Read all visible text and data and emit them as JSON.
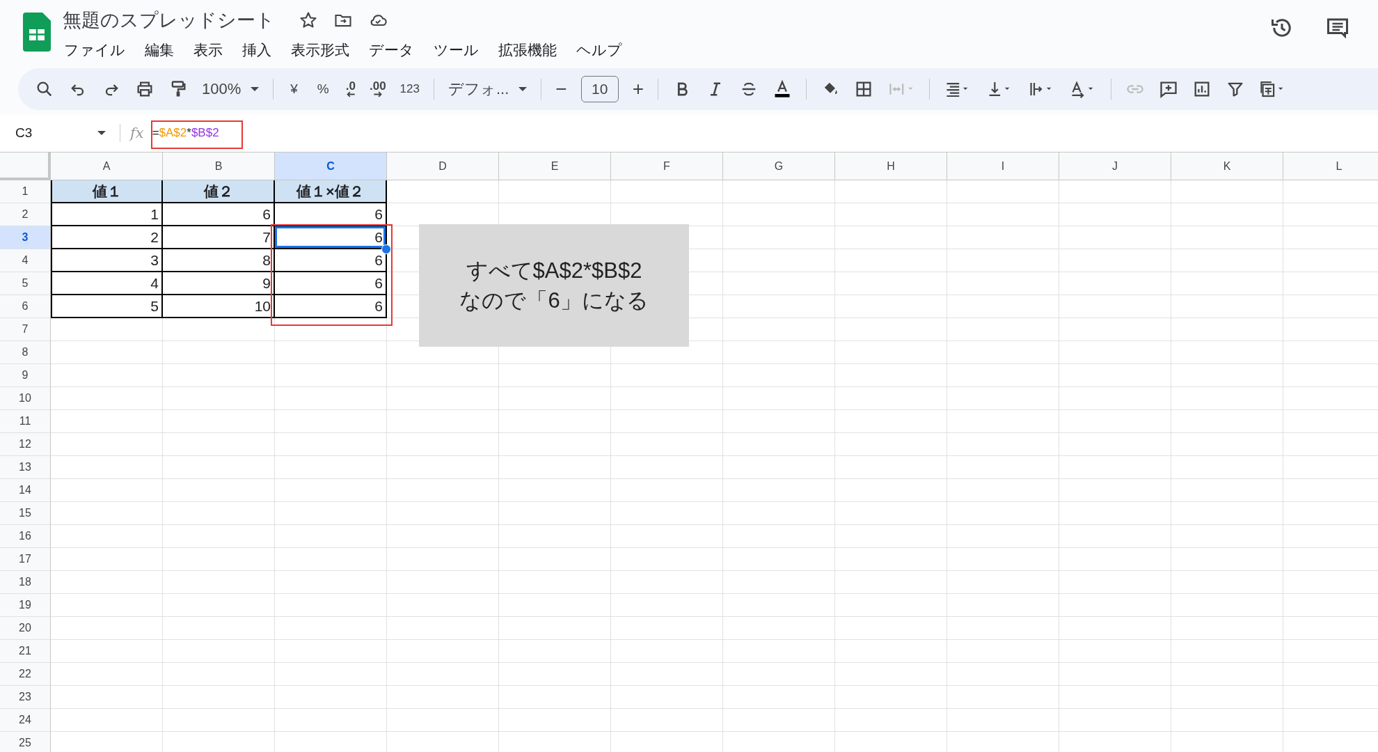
{
  "app": {
    "title": "無題のスプレッドシート"
  },
  "menu": [
    "ファイル",
    "編集",
    "表示",
    "挿入",
    "表示形式",
    "データ",
    "ツール",
    "拡張機能",
    "ヘルプ"
  ],
  "toolbar": {
    "zoom": "100%",
    "currency": "¥",
    "percent": "%",
    "decrease_decimal": ".0",
    "increase_decimal": ".00",
    "number_format": "123",
    "font": "デフォ...",
    "font_size": "10",
    "minus": "−",
    "plus": "+"
  },
  "name_box": "C3",
  "formula_label": "fx",
  "formula": [
    {
      "text": "=",
      "color": "#202124"
    },
    {
      "text": "$A$2",
      "color": "#f29900"
    },
    {
      "text": "*",
      "color": "#202124"
    },
    {
      "text": "$B$2",
      "color": "#9334e6"
    }
  ],
  "columns": [
    {
      "label": "A",
      "selected": false
    },
    {
      "label": "B",
      "selected": false
    },
    {
      "label": "C",
      "selected": true
    },
    {
      "label": "D",
      "selected": false
    },
    {
      "label": "E",
      "selected": false
    },
    {
      "label": "F",
      "selected": false
    },
    {
      "label": "G",
      "selected": false
    },
    {
      "label": "H",
      "selected": false
    },
    {
      "label": "I",
      "selected": false
    },
    {
      "label": "J",
      "selected": false
    },
    {
      "label": "K",
      "selected": false
    },
    {
      "label": "L",
      "selected": false
    }
  ],
  "rows": [
    {
      "number": "1",
      "selected": false,
      "kind": "header",
      "cells": [
        {
          "text": "値１",
          "selected": false
        },
        {
          "text": "値２",
          "selected": false
        },
        {
          "text": "値１×値２",
          "selected": false
        }
      ]
    },
    {
      "number": "2",
      "selected": false,
      "kind": "data",
      "cells": [
        {
          "text": "1",
          "selected": false
        },
        {
          "text": "6",
          "selected": false
        },
        {
          "text": "6",
          "selected": false
        }
      ]
    },
    {
      "number": "3",
      "selected": true,
      "kind": "data",
      "cells": [
        {
          "text": "2",
          "selected": false
        },
        {
          "text": "7",
          "selected": false
        },
        {
          "text": "6",
          "selected": true
        }
      ]
    },
    {
      "number": "4",
      "selected": false,
      "kind": "data",
      "cells": [
        {
          "text": "3",
          "selected": false
        },
        {
          "text": "8",
          "selected": false
        },
        {
          "text": "6",
          "selected": false
        }
      ]
    },
    {
      "number": "5",
      "selected": false,
      "kind": "data",
      "cells": [
        {
          "text": "4",
          "selected": false
        },
        {
          "text": "9",
          "selected": false
        },
        {
          "text": "6",
          "selected": false
        }
      ]
    },
    {
      "number": "6",
      "selected": false,
      "kind": "data",
      "cells": [
        {
          "text": "5",
          "selected": false
        },
        {
          "text": "10",
          "selected": false
        },
        {
          "text": "6",
          "selected": false
        }
      ]
    },
    {
      "number": "7",
      "selected": false
    },
    {
      "number": "8",
      "selected": false
    },
    {
      "number": "9",
      "selected": false
    },
    {
      "number": "10",
      "selected": false
    },
    {
      "number": "11",
      "selected": false
    },
    {
      "number": "12",
      "selected": false
    },
    {
      "number": "13",
      "selected": false
    },
    {
      "number": "14",
      "selected": false
    },
    {
      "number": "15",
      "selected": false
    },
    {
      "number": "16",
      "selected": false
    },
    {
      "number": "17",
      "selected": false
    },
    {
      "number": "18",
      "selected": false
    },
    {
      "number": "19",
      "selected": false
    },
    {
      "number": "20",
      "selected": false
    },
    {
      "number": "21",
      "selected": false
    },
    {
      "number": "22",
      "selected": false
    },
    {
      "number": "23",
      "selected": false
    },
    {
      "number": "24",
      "selected": false
    },
    {
      "number": "25",
      "selected": false
    }
  ],
  "callout": {
    "text": "すべて$A$2*$B$2\nなので「6」になる"
  }
}
